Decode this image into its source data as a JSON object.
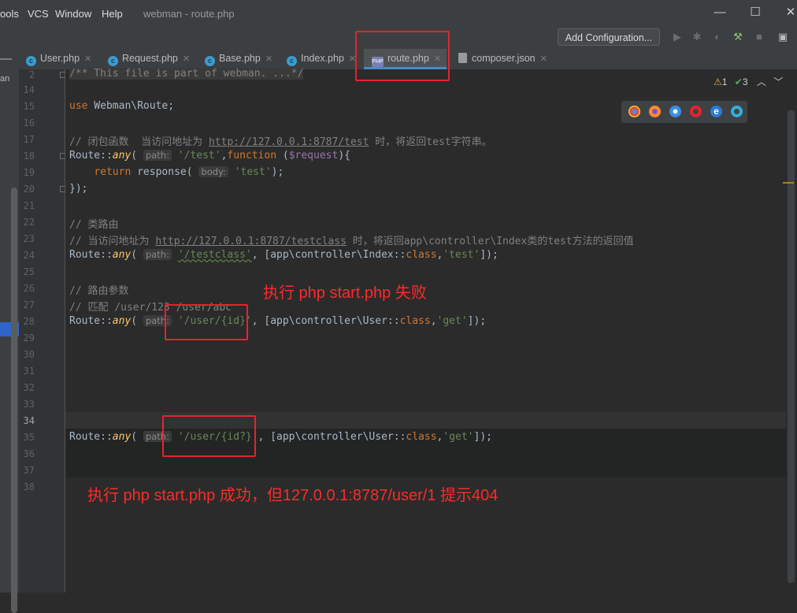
{
  "menu": [
    "ools",
    "VCS",
    "Window",
    "Help"
  ],
  "window_title": "webman - route.php",
  "window_buttons": [
    "—",
    "☐",
    "✕"
  ],
  "toolbar": {
    "add_configuration": "Add Configuration..."
  },
  "tabs": [
    {
      "label": "User.php",
      "icon": "class-icon"
    },
    {
      "label": "Request.php",
      "icon": "class-icon"
    },
    {
      "label": "Base.php",
      "icon": "class-icon"
    },
    {
      "label": "Index.php",
      "icon": "class-icon"
    },
    {
      "label": "route.php",
      "icon": "php-file-icon",
      "active": true
    },
    {
      "label": "composer.json",
      "icon": "json-file-icon"
    }
  ],
  "sidebar_label": "an",
  "line_numbers": [
    "2",
    "14",
    "15",
    "16",
    "17",
    "18",
    "19",
    "20",
    "21",
    "22",
    "23",
    "24",
    "25",
    "26",
    "27",
    "28",
    "29",
    "30",
    "31",
    "32",
    "33",
    "34",
    "35",
    "36",
    "37",
    "38"
  ],
  "inspections": {
    "warnings": "1",
    "ok": "3"
  },
  "code": {
    "l2": "/** This file is part of webman. ...*/",
    "l15_kw": "use",
    "l15_rest": " Webman\\Route;",
    "l17_text": "// 闭包函数  当访问地址为 ",
    "l17_url": "http://127.0.0.1:8787/test",
    "l17_tail": " 时，将返回test字符串。",
    "route": "Route::",
    "any": "any",
    "hint_path": "path:",
    "hint_body": "body:",
    "l18_str": "'/test'",
    "l18_function": "function",
    "l18_var": "$request",
    "l19_return": "return",
    "l19_fn": "response",
    "l19_str": "'test'",
    "l20": "});",
    "l22": "// 类路由",
    "l23_text": "// 当访问地址为 ",
    "l23_url": "http://127.0.0.1:8787/testclass",
    "l23_tail": " 时，将返回app\\controller\\Index类的test方法的返回值",
    "l24_str": "'/testclass'",
    "l24_ctrl": "[app\\controller\\Index::",
    "class_kw": "class",
    "l24_method": "'test'",
    "l26": "// 路由参数",
    "l27": "// 匹配 /user/123 /user/abc",
    "l28_str": "'/user/{id}'",
    "user_ctrl": "[app\\controller\\User::",
    "get_str": "'get'",
    "l35_str": "'/user/{id?}'"
  },
  "annotations": {
    "fail": "执行 php start.php 失败",
    "success": "执行 php start.php 成功，但127.0.0.1:8787/user/1 提示404"
  },
  "colors": {
    "annotation": "#ff2a2a",
    "keyword": "#cc7832",
    "string": "#6a8759",
    "comment": "#808080"
  }
}
